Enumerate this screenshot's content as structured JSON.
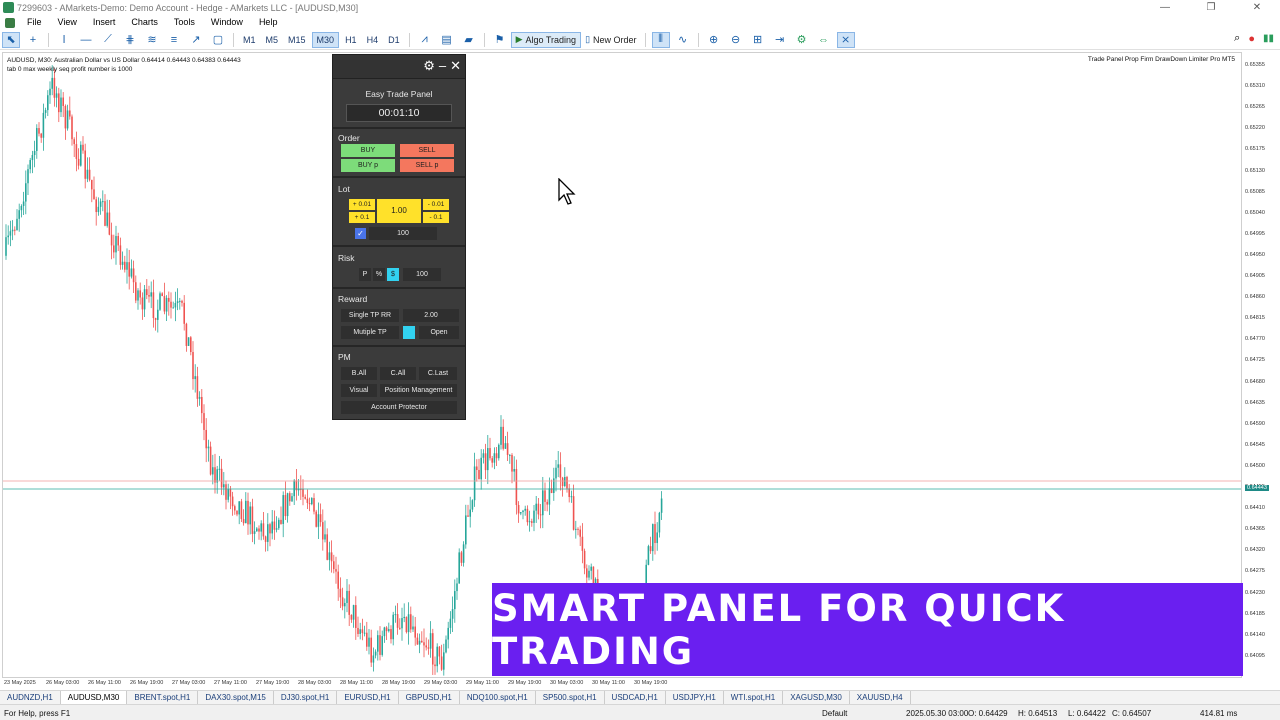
{
  "window": {
    "title": "7299603 - AMarkets-Demo: Demo Account - Hedge - AMarkets LLC - [AUDUSD,M30]",
    "minimize": "—",
    "maximize": "❐",
    "close": "✕"
  },
  "menu": [
    "File",
    "View",
    "Insert",
    "Charts",
    "Tools",
    "Window",
    "Help"
  ],
  "toolbar": {
    "timeframes": [
      "M1",
      "M5",
      "M15",
      "M30",
      "H1",
      "H4",
      "D1"
    ],
    "active_timeframe": "M30",
    "algo_trading": "Algo Trading",
    "new_order": "New Order"
  },
  "chart": {
    "info_line1": "AUDUSD, M30:  Australian Dollar vs US Dollar  0.64414 0.64443 0.64383 0.64443",
    "info_line2": "tab 0 max weekly seq profit number is 1000",
    "ea_name": "Trade Panel Prop Firm DrawDown Limiter Pro MT5",
    "price_ticks": [
      "0.65355",
      "0.65310",
      "0.65265",
      "0.65220",
      "0.65175",
      "0.65130",
      "0.65085",
      "0.65040",
      "0.64995",
      "0.64950",
      "0.64905",
      "0.64860",
      "0.64815",
      "0.64770",
      "0.64725",
      "0.64680",
      "0.64635",
      "0.64590",
      "0.64545",
      "0.64500",
      "0.64455",
      "0.64410",
      "0.64365",
      "0.64320",
      "0.64275",
      "0.64230",
      "0.64185",
      "0.64140",
      "0.64095"
    ],
    "current_price_label": "0.64443",
    "time_ticks": [
      "23 May 2025",
      "26 May 03:00",
      "26 May 11:00",
      "26 May 19:00",
      "27 May 03:00",
      "27 May 11:00",
      "27 May 19:00",
      "28 May 03:00",
      "28 May 11:00",
      "28 May 19:00",
      "29 May 03:00",
      "29 May 11:00",
      "29 May 19:00",
      "30 May 03:00",
      "30 May 11:00",
      "30 May 19:00"
    ]
  },
  "panel": {
    "title": "Easy Trade Panel",
    "timer": "00:01:10",
    "order_label": "Order",
    "buy": "BUY",
    "sell": "SELL",
    "buy_p": "BUY p",
    "sell_p": "SELL p",
    "lot_label": "Lot",
    "lot_plus_001": "+ 0.01",
    "lot_plus_01": "+ 0.1",
    "lot_value": "1.00",
    "lot_minus_001": "- 0.01",
    "lot_minus_01": "- 0.1",
    "lot_multiplier": "100",
    "risk_label": "Risk",
    "risk_p": "P",
    "risk_pct": "%",
    "risk_dollar": "$",
    "risk_value": "100",
    "reward_label": "Reward",
    "single_tp": "Single TP RR",
    "rr_value": "2.00",
    "multiple_tp": "Mutiple TP",
    "open": "Open",
    "pm_label": "PM",
    "b_all": "B.All",
    "c_all": "C.All",
    "c_last": "C.Last",
    "visual": "Visual",
    "position_mgmt": "Position Management",
    "account_protector": "Account Protector"
  },
  "banner_text": "SMART PANEL FOR QUICK TRADING",
  "tabs": [
    "AUDNZD,H1",
    "AUDUSD,M30",
    "BRENT.spot,H1",
    "DAX30.spot,M15",
    "DJ30.spot,H1",
    "EURUSD,H1",
    "GBPUSD,H1",
    "NDQ100.spot,H1",
    "SP500.spot,H1",
    "USDCAD,H1",
    "USDJPY,H1",
    "WTI.spot,H1",
    "XAGUSD,M30",
    "XAUUSD,H4"
  ],
  "active_tab": "AUDUSD,M30",
  "status": {
    "help": "For Help, press F1",
    "profile": "Default",
    "datetime": "2025.05.30 03:00",
    "open": "O: 0.64429",
    "high": "H: 0.64513",
    "low": "L: 0.64422",
    "close": "C: 0.64507",
    "traffic": "414.81 ms"
  },
  "colors": {
    "bull": "#26a69a",
    "bear": "#ef5350",
    "banner": "#6a1ff0"
  }
}
